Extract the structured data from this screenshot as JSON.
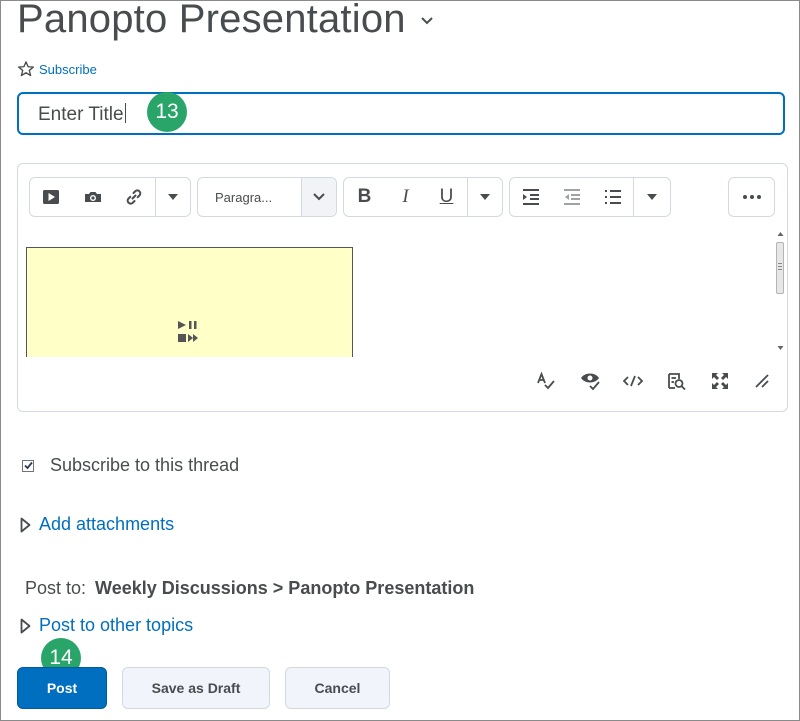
{
  "page": {
    "title": "Panopto Presentation",
    "subscribe_link": "Subscribe"
  },
  "title_field": {
    "value": "Enter Title"
  },
  "badges": {
    "title_step": "13",
    "post_step": "14"
  },
  "toolbar": {
    "format_select": "Paragra...",
    "bold_label": "B",
    "italic_label": "I",
    "underline_label": "U"
  },
  "options": {
    "subscribe_thread": "Subscribe to this thread",
    "subscribe_thread_checked": true,
    "add_attachments": "Add attachments"
  },
  "post_to": {
    "label": "Post to:",
    "path": "Weekly Discussions > Panopto Presentation",
    "other_topics": "Post to other topics"
  },
  "actions": {
    "post": "Post",
    "save_draft": "Save as Draft",
    "cancel": "Cancel"
  },
  "colors": {
    "accent": "#006fbf",
    "badge": "#2aa56a",
    "video_placeholder": "#ffffc8"
  }
}
